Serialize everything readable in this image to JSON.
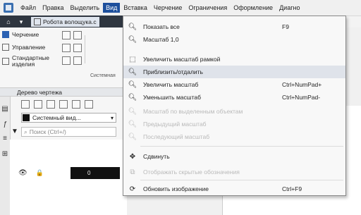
{
  "menubar": {
    "items": [
      "Файл",
      "Правка",
      "Выделить",
      "Вид",
      "Вставка",
      "Черчение",
      "Ограничения",
      "Оформление",
      "Диагно"
    ],
    "active_index": 3
  },
  "document_tab": {
    "label": "Робота волощука.с"
  },
  "left_panel": {
    "ribbon_group": "Черчение",
    "management": "Управление",
    "standard_items": "Стандартные изделия",
    "system_label": "Системная",
    "tree_title": "Дерево чертежа",
    "combo_value": "Системный вид...",
    "search_placeholder": "Поиск (Ctrl+/)",
    "tree_row_value": "0"
  },
  "view_menu": {
    "items": [
      {
        "icon": "magnifier-icon",
        "label": "Показать все",
        "shortcut": "F9",
        "disabled": false
      },
      {
        "icon": "magnifier-icon",
        "label": "Масштаб 1,0",
        "shortcut": "",
        "disabled": false
      },
      {
        "icon": "zoom-frame-icon",
        "label": "Увеличить масштаб рамкой",
        "shortcut": "",
        "disabled": false
      },
      {
        "icon": "zoom-in-out-icon",
        "label": "Приблизить/отдалить",
        "shortcut": "",
        "disabled": false,
        "highlight": true
      },
      {
        "icon": "zoom-in-icon",
        "label": "Увеличить масштаб",
        "shortcut": "Ctrl+NumPad+",
        "disabled": false
      },
      {
        "icon": "zoom-out-icon",
        "label": "Уменьшить масштаб",
        "shortcut": "Ctrl+NumPad-",
        "disabled": false
      },
      {
        "icon": "zoom-selection-icon",
        "label": "Масштаб по выделенным объектам",
        "shortcut": "",
        "disabled": true
      },
      {
        "icon": "previous-zoom-icon",
        "label": "Предыдущий масштаб",
        "shortcut": "",
        "disabled": true
      },
      {
        "icon": "next-zoom-icon",
        "label": "Последующий масштаб",
        "shortcut": "",
        "disabled": true
      },
      {
        "icon": "pan-icon",
        "label": "Сдвинуть",
        "shortcut": "",
        "disabled": false
      },
      {
        "icon": "hidden-objects-icon",
        "label": "Отображать скрытые обозначения",
        "shortcut": "",
        "disabled": true
      },
      {
        "icon": "refresh-icon",
        "label": "Обновить изображение",
        "shortcut": "Ctrl+F9",
        "disabled": false
      }
    ]
  },
  "colors": {
    "menu_active_bg": "#1d4f9c",
    "dark_bar": "#2f3640",
    "disabled_text": "#b9b9b9",
    "highlight_row": "#dfe3ea"
  }
}
